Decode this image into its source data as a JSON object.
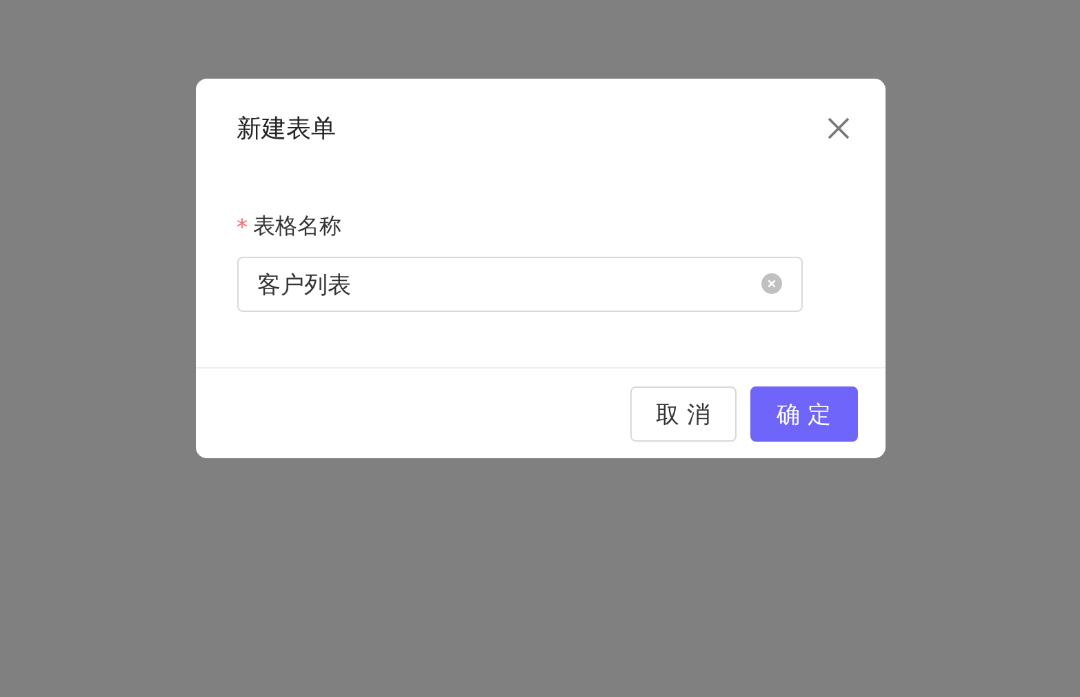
{
  "dialog": {
    "title": "新建表单",
    "form": {
      "fields": [
        {
          "label": "表格名称",
          "required": true,
          "required_mark": "*",
          "value": "客户列表",
          "clearable": true
        }
      ]
    },
    "buttons": [
      {
        "label": "取 消",
        "kind": "default"
      },
      {
        "label": "确 定",
        "kind": "primary"
      }
    ]
  }
}
